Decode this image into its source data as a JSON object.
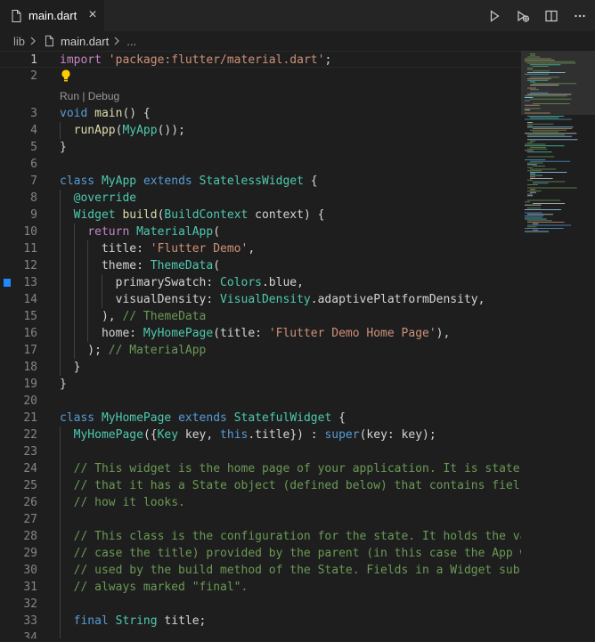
{
  "tab": {
    "label": "main.dart",
    "close": "×"
  },
  "toolbar": {
    "run_icon": "run-icon",
    "debug_icon": "debug-icon",
    "split_icon": "split-editor-icon",
    "more_icon": "more-icon"
  },
  "breadcrumbs": {
    "folder": "lib",
    "file": "main.dart",
    "more": "..."
  },
  "codelens": "Run | Debug",
  "colors": {
    "keyword": "#569cd6",
    "string": "#ce9178",
    "class": "#4ec9b0",
    "function": "#dcdcaa",
    "variable": "#9cdcfe",
    "comment": "#6a9955"
  },
  "lines": [
    {
      "n": "1",
      "html": "<span class=\"kw2\">import</span> <span class=\"str\">'package:flutter/material.dart'</span>;"
    },
    {
      "n": "2",
      "html": ""
    },
    {
      "n": "3",
      "html": "<span class=\"kw\">void</span> <span class=\"fn\">main</span>() {"
    },
    {
      "n": "4",
      "html": "  <span class=\"fn\">runApp</span>(<span class=\"cls\">MyApp</span>());"
    },
    {
      "n": "5",
      "html": "}"
    },
    {
      "n": "6",
      "html": ""
    },
    {
      "n": "7",
      "html": "<span class=\"kw\">class</span> <span class=\"cls\">MyApp</span> <span class=\"kw\">extends</span> <span class=\"cls\">StatelessWidget</span> {"
    },
    {
      "n": "8",
      "html": "  <span class=\"ann\">@override</span>"
    },
    {
      "n": "9",
      "html": "  <span class=\"cls\">Widget</span> <span class=\"fn\">build</span>(<span class=\"cls\">BuildContext</span> context) {"
    },
    {
      "n": "10",
      "html": "    <span class=\"kw2\">return</span> <span class=\"cls\">MaterialApp</span>("
    },
    {
      "n": "11",
      "html": "      title: <span class=\"str\">'Flutter Demo'</span>,"
    },
    {
      "n": "12",
      "html": "      theme: <span class=\"cls\">ThemeData</span>("
    },
    {
      "n": "13",
      "html": "        primarySwatch: <span class=\"cls\">Colors</span>.blue,"
    },
    {
      "n": "14",
      "html": "        visualDensity: <span class=\"cls\">VisualDensity</span>.adaptivePlatformDensity,"
    },
    {
      "n": "15",
      "html": "      ), <span class=\"com\">// ThemeData</span>"
    },
    {
      "n": "16",
      "html": "      home: <span class=\"cls\">MyHomePage</span>(title: <span class=\"str\">'Flutter Demo Home Page'</span>),"
    },
    {
      "n": "17",
      "html": "    ); <span class=\"com\">// MaterialApp</span>"
    },
    {
      "n": "18",
      "html": "  }"
    },
    {
      "n": "19",
      "html": "}"
    },
    {
      "n": "20",
      "html": ""
    },
    {
      "n": "21",
      "html": "<span class=\"kw\">class</span> <span class=\"cls\">MyHomePage</span> <span class=\"kw\">extends</span> <span class=\"cls\">StatefulWidget</span> {"
    },
    {
      "n": "22",
      "html": "  <span class=\"cls\">MyHomePage</span>({<span class=\"cls\">Key</span> key, <span class=\"kw\">this</span>.title}) : <span class=\"kw\">super</span>(key: key);"
    },
    {
      "n": "23",
      "html": ""
    },
    {
      "n": "24",
      "html": "  <span class=\"com\">// This widget is the home page of your application. It is statef</span>"
    },
    {
      "n": "25",
      "html": "  <span class=\"com\">// that it has a State object (defined below) that contains fielc</span>"
    },
    {
      "n": "26",
      "html": "  <span class=\"com\">// how it looks.</span>"
    },
    {
      "n": "27",
      "html": ""
    },
    {
      "n": "28",
      "html": "  <span class=\"com\">// This class is the configuration for the state. It holds the va</span>"
    },
    {
      "n": "29",
      "html": "  <span class=\"com\">// case the title) provided by the parent (in this case the App w</span>"
    },
    {
      "n": "30",
      "html": "  <span class=\"com\">// used by the build method of the State. Fields in a Widget subc</span>"
    },
    {
      "n": "31",
      "html": "  <span class=\"com\">// always marked \"final\".</span>"
    },
    {
      "n": "32",
      "html": ""
    },
    {
      "n": "33",
      "html": "  <span class=\"kw\">final</span> <span class=\"cls\">String</span> title;"
    },
    {
      "n": "34",
      "html": ""
    }
  ]
}
